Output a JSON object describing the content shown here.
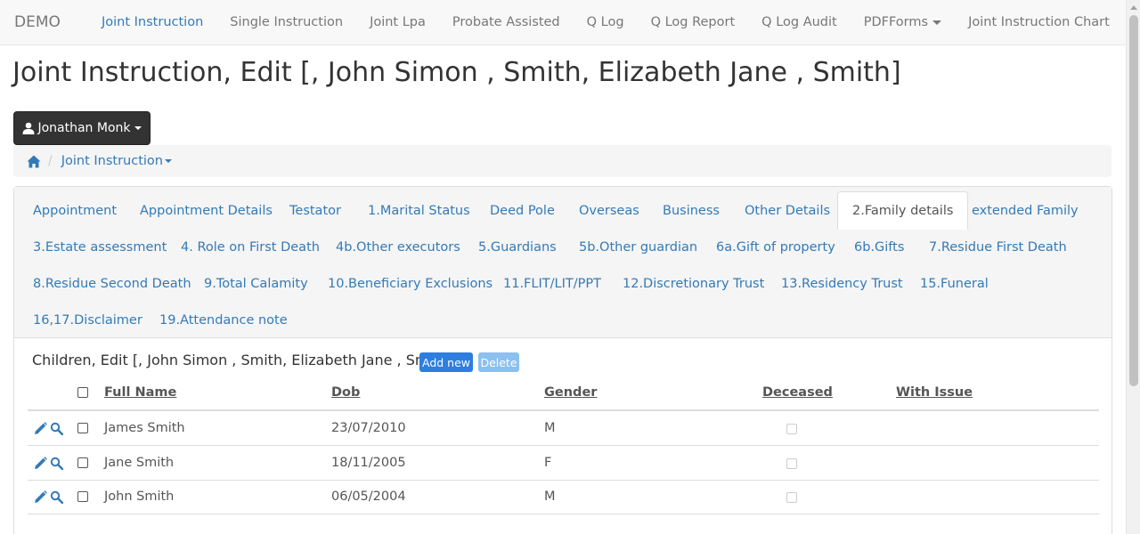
{
  "navbar": {
    "brand": "DEMO",
    "links": [
      {
        "label": "Joint Instruction",
        "active": true
      },
      {
        "label": "Single Instruction"
      },
      {
        "label": "Joint Lpa"
      },
      {
        "label": "Probate Assisted"
      },
      {
        "label": "Q Log"
      },
      {
        "label": "Q Log Report"
      },
      {
        "label": "Q Log Audit"
      },
      {
        "label": "PDFForms"
      },
      {
        "label": "Joint Instruction Chart"
      }
    ]
  },
  "page": {
    "title": "Joint Instruction, Edit [, John Simon , Smith, Elizabeth Jane , Smith]"
  },
  "user_menu": {
    "label": "Jonathan Monk"
  },
  "breadcrumb": {
    "current": "Joint Instruction"
  },
  "tabs": [
    "Appointment",
    "Appointment Details",
    "Testator",
    "1.Marital Status",
    "Deed Pole",
    "Overseas",
    "Business",
    "Other Details",
    "2.Family details",
    "extended Family",
    "3.Estate assessment",
    "4. Role on First Death",
    "4b.Other executors",
    "5.Guardians",
    "5b.Other guardian",
    "6a.Gift of property",
    "6b.Gifts",
    "7.Residue First Death",
    "8.Residue Second Death",
    "9.Total Calamity",
    "10.Beneficiary Exclusions",
    "11.FLIT/LIT/PPT",
    "12.Discretionary Trust",
    "13.Residency Trust",
    "15.Funeral",
    "16,17.Disclaimer",
    "19.Attendance note"
  ],
  "active_tab": "2.Family details",
  "children": {
    "title": "Children, Edit [, John Simon , Smith, Elizabeth Jane , Smith]",
    "add_label": "Add new",
    "delete_label": "Delete",
    "columns": [
      "Full Name",
      "Dob",
      "Gender",
      "Deceased",
      "With Issue"
    ],
    "rows": [
      {
        "name": "James Smith",
        "dob": "23/07/2010",
        "gender": "M",
        "deceased": false
      },
      {
        "name": "Jane Smith",
        "dob": "18/11/2005",
        "gender": "F",
        "deceased": false
      },
      {
        "name": "John Smith",
        "dob": "06/05/2004",
        "gender": "M",
        "deceased": false
      }
    ]
  },
  "colors": {
    "link": "#337ab7",
    "add_button": "#2e7ee0",
    "delete_button": "#8cc0f0",
    "user_button": "#333333"
  },
  "icons": [
    "user-icon",
    "home-icon",
    "pencil-icon",
    "magnifier-icon"
  ]
}
